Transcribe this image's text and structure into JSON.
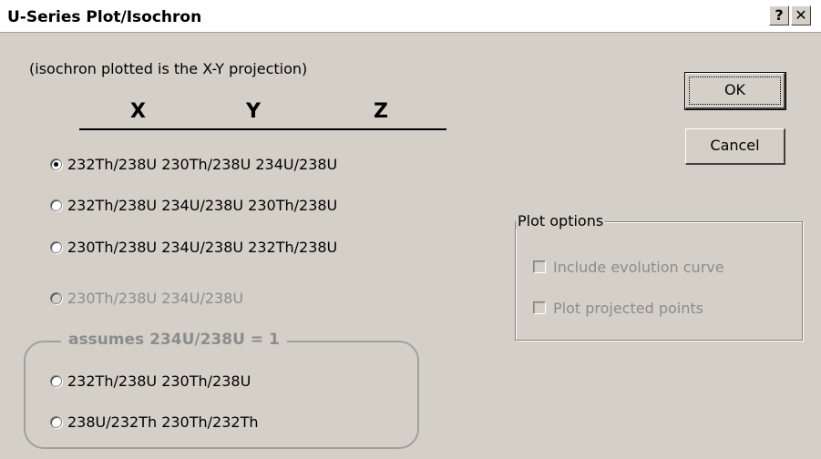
{
  "window": {
    "title": "U-Series Plot/Isochron",
    "help_label": "?",
    "close_label": "✕"
  },
  "note": "(isochron plotted is the X-Y projection)",
  "columns": {
    "x": "X",
    "y": "Y",
    "z": "Z"
  },
  "options": [
    {
      "x": "232Th/238U",
      "y": "230Th/238U",
      "z": "234U/238U",
      "checked": true,
      "enabled": true
    },
    {
      "x": "232Th/238U",
      "y": "234U/238U",
      "z": "230Th/238U",
      "checked": false,
      "enabled": true
    },
    {
      "x": "230Th/238U",
      "y": "234U/238U",
      "z": "232Th/238U",
      "checked": false,
      "enabled": true
    },
    {
      "x": "230Th/238U",
      "y": "234U/238U",
      "z": "",
      "checked": false,
      "enabled": false
    }
  ],
  "assumes_group": {
    "title": "assumes 234U/238U = 1",
    "options": [
      {
        "x": "232Th/238U",
        "y": "230Th/238U",
        "checked": false
      },
      {
        "x": "238U/232Th",
        "y": "230Th/232Th",
        "checked": false
      }
    ]
  },
  "buttons": {
    "ok": "OK",
    "cancel": "Cancel"
  },
  "plot_options": {
    "title": "Plot options",
    "include_evolution_curve": {
      "label": "Include evolution curve",
      "checked": false,
      "enabled": false
    },
    "plot_projected_points": {
      "label": "Plot projected points",
      "checked": false,
      "enabled": false
    }
  }
}
